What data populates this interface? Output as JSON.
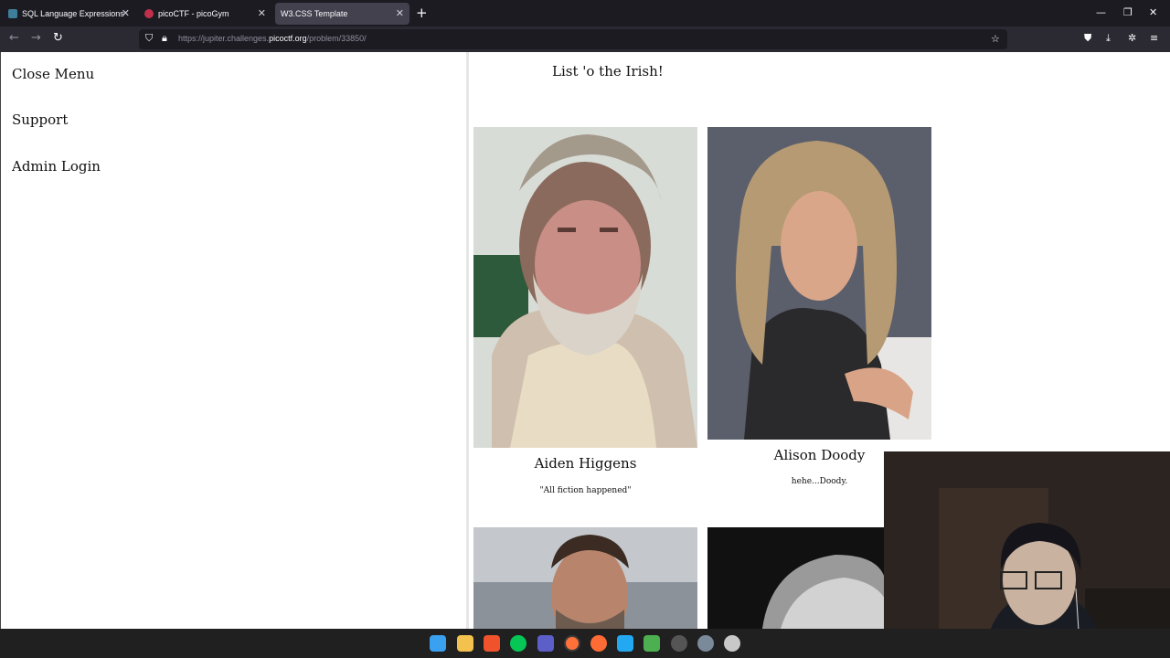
{
  "browser": {
    "tabs": [
      {
        "label": "SQL Language Expressions",
        "active": false,
        "favicon_color": "#3d7e9a"
      },
      {
        "label": "picoCTF - picoGym",
        "active": false,
        "favicon_color": "#c0304a"
      },
      {
        "label": "W3.CSS Template",
        "active": true,
        "favicon_color": ""
      }
    ],
    "url_scheme_host_prefix": "https://jupiter.challenges.",
    "url_host": "picoctf.org",
    "url_path": "/problem/33850/"
  },
  "sidebar": {
    "items": [
      {
        "label": "Close Menu"
      },
      {
        "label": "Support"
      },
      {
        "label": "Admin Login"
      }
    ]
  },
  "main": {
    "heading": "List 'o the Irish!",
    "cards": [
      {
        "name": "Aiden Higgens",
        "quote": "\"All fiction happened\""
      },
      {
        "name": "Alison Doody",
        "quote": "hehe...Doody."
      }
    ]
  },
  "taskbar": {
    "apps": [
      "windows-start",
      "file-explorer",
      "brave",
      "line",
      "teams",
      "firefox",
      "app-orange",
      "vscode",
      "notepad",
      "app-red-badge",
      "settings",
      "app-gray"
    ]
  }
}
